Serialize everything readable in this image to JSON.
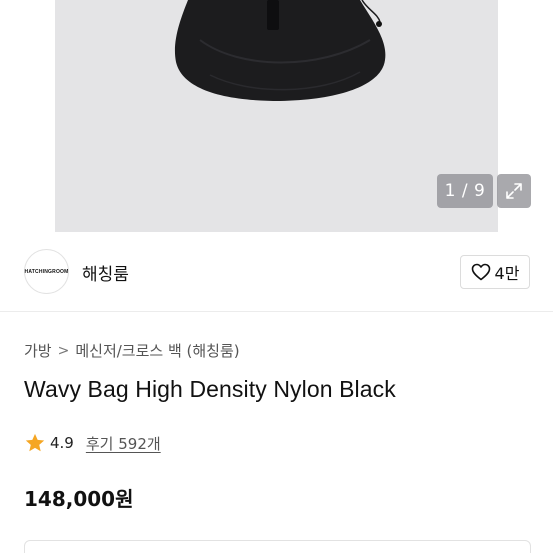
{
  "gallery": {
    "counter_text": "1 / 9"
  },
  "store": {
    "logo_text": "HATCHINGROOM",
    "name": "해칭룸",
    "like_count": "4만"
  },
  "breadcrumb": {
    "items": [
      "가방",
      "메신저/크로스 백 (해칭룸)"
    ],
    "separator": ">"
  },
  "product": {
    "title": "Wavy Bag High Density Nylon Black",
    "rating": "4.9",
    "review_label": "후기 592개",
    "price": "148,000원"
  },
  "colors": {
    "star": "#f5a623",
    "photo_background": "#e4e4e6"
  }
}
